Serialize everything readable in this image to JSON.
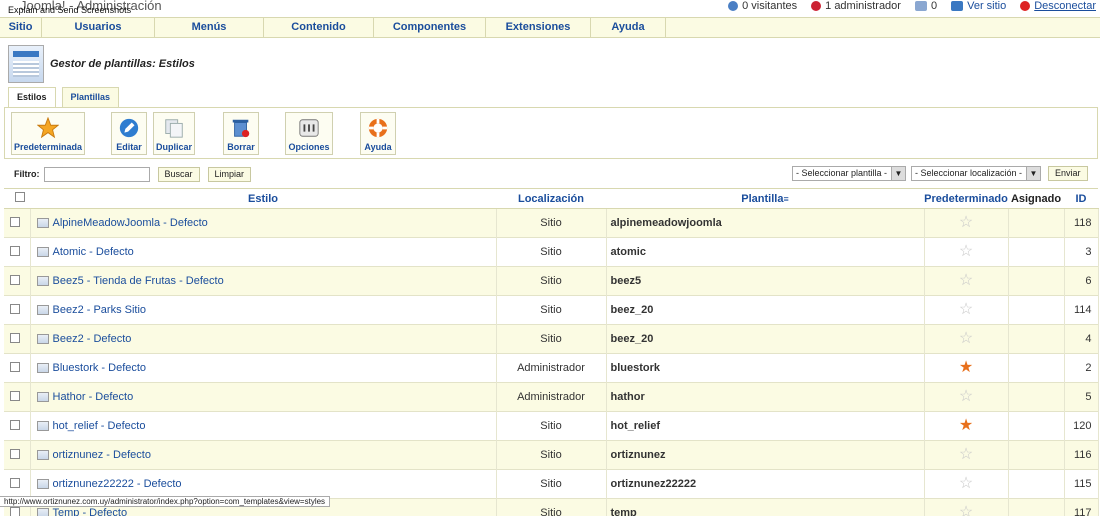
{
  "window_caption": "Explain and Send Screenshots",
  "app_title": "Joomla! - Administración",
  "status": {
    "visitors": "0 visitantes",
    "admins": "1 administrador",
    "messages": "0",
    "view_site": "Ver sitio",
    "logout": "Desconectar"
  },
  "menu": [
    "Sitio",
    "Usuarios",
    "Menús",
    "Contenido",
    "Componentes",
    "Extensiones",
    "Ayuda"
  ],
  "page_title": "Gestor de plantillas: Estilos",
  "tabs": [
    "Estilos",
    "Plantillas"
  ],
  "toolbar": {
    "default": "Predeterminada",
    "edit": "Editar",
    "duplicate": "Duplicar",
    "delete": "Borrar",
    "options": "Opciones",
    "help": "Ayuda"
  },
  "filter": {
    "label": "Filtro:",
    "search_btn": "Buscar",
    "clear_btn": "Limpiar",
    "select_template": "- Seleccionar plantilla -",
    "select_location": "- Seleccionar localización -",
    "submit": "Enviar"
  },
  "columns": {
    "style": "Estilo",
    "location": "Localización",
    "template": "Plantilla",
    "default": "Predeterminado",
    "assigned": "Asignado",
    "id": "ID"
  },
  "rows": [
    {
      "style": "AlpineMeadowJoomla - Defecto",
      "location": "Sitio",
      "template": "alpinemeadowjoomla",
      "default": false,
      "id": "118"
    },
    {
      "style": "Atomic - Defecto",
      "location": "Sitio",
      "template": "atomic",
      "default": false,
      "id": "3"
    },
    {
      "style": "Beez5 - Tienda de Frutas - Defecto",
      "location": "Sitio",
      "template": "beez5",
      "default": false,
      "id": "6"
    },
    {
      "style": "Beez2 - Parks Sitio",
      "location": "Sitio",
      "template": "beez_20",
      "default": false,
      "id": "114"
    },
    {
      "style": "Beez2 - Defecto",
      "location": "Sitio",
      "template": "beez_20",
      "default": false,
      "id": "4"
    },
    {
      "style": "Bluestork - Defecto",
      "location": "Administrador",
      "template": "bluestork",
      "default": true,
      "id": "2"
    },
    {
      "style": "Hathor - Defecto",
      "location": "Administrador",
      "template": "hathor",
      "default": false,
      "id": "5"
    },
    {
      "style": "hot_relief - Defecto",
      "location": "Sitio",
      "template": "hot_relief",
      "default": true,
      "id": "120"
    },
    {
      "style": "ortiznunez - Defecto",
      "location": "Sitio",
      "template": "ortiznunez",
      "default": false,
      "id": "116"
    },
    {
      "style": "ortiznunez22222 - Defecto",
      "location": "Sitio",
      "template": "ortiznunez22222",
      "default": false,
      "id": "115"
    },
    {
      "style": "Temp - Defecto",
      "location": "Sitio",
      "template": "temp",
      "default": false,
      "id": "117"
    }
  ],
  "status_url": "http://www.ortiznunez.com.uy/administrator/index.php?option=com_templates&view=styles",
  "colors": {
    "accent": "#1a4d9c",
    "row_alt": "#fbfbe3",
    "star_on": "#e8701c",
    "star_off": "#c8c8c8"
  }
}
